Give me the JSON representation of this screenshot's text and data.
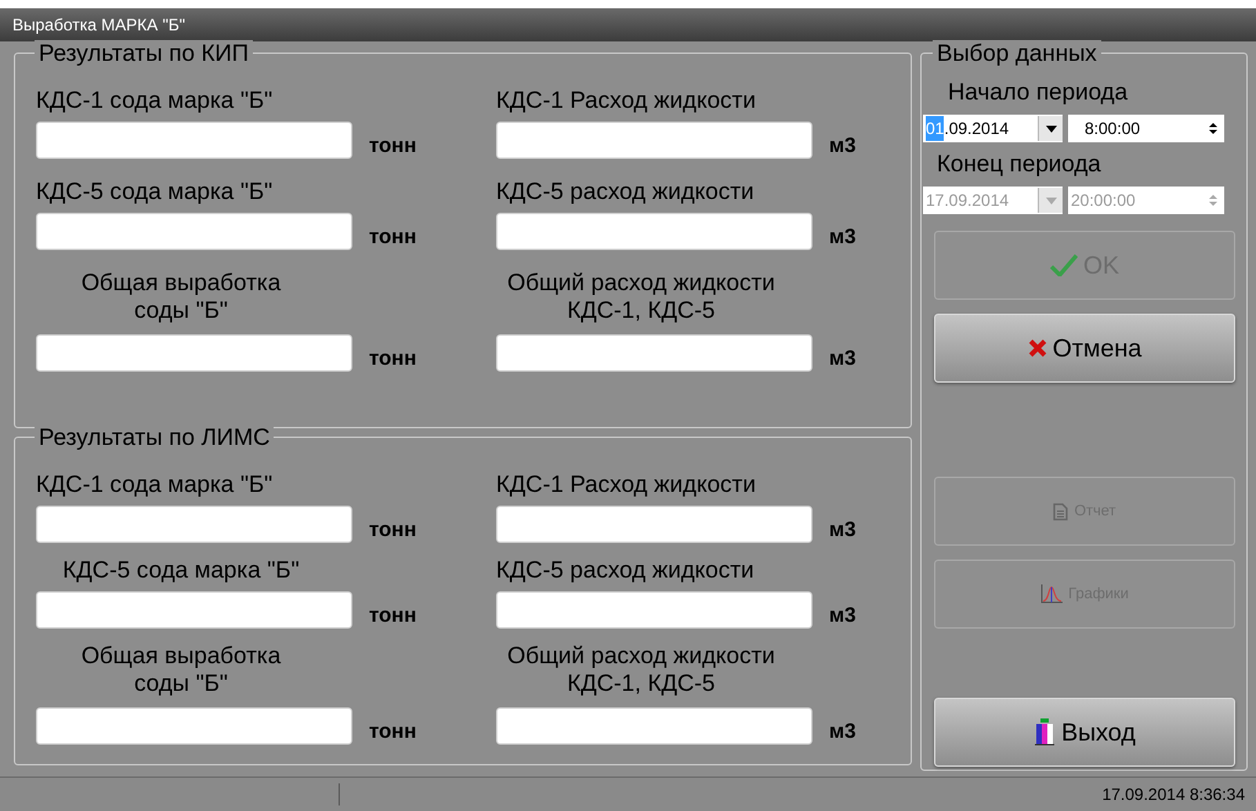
{
  "window": {
    "title": "Выработка МАРКА \"Б\""
  },
  "groups": [
    {
      "title": "Результаты по КИП",
      "fields": [
        {
          "label": "КДС-1 сода марка \"Б\"",
          "unit": "тонн",
          "centered": false
        },
        {
          "label": "КДС-1 Расход жидкости",
          "unit": "м3",
          "centered": false
        },
        {
          "label": "КДС-5 сода марка \"Б\"",
          "unit": "тонн",
          "centered": false
        },
        {
          "label": "КДС-5 расход жидкости",
          "unit": "м3",
          "centered": false
        },
        {
          "label": "Общая выработка\nсоды \"Б\"",
          "unit": "тонн",
          "centered": true
        },
        {
          "label": "Общий расход жидкости\nКДС-1, КДС-5",
          "unit": "м3",
          "centered": true
        }
      ]
    },
    {
      "title": "Результаты по ЛИМС",
      "fields": [
        {
          "label": "КДС-1 сода марка \"Б\"",
          "unit": "тонн",
          "centered": false
        },
        {
          "label": "КДС-1 Расход жидкости",
          "unit": "м3",
          "centered": false
        },
        {
          "label": "КДС-5 сода марка \"Б\"",
          "unit": "тонн",
          "centered": true
        },
        {
          "label": "КДС-5 расход жидкости",
          "unit": "м3",
          "centered": false
        },
        {
          "label": "Общая выработка\nсоды \"Б\"",
          "unit": "тонн",
          "centered": true
        },
        {
          "label": "Общий расход жидкости\nКДС-1, КДС-5",
          "unit": "м3",
          "centered": true
        }
      ]
    }
  ],
  "selection": {
    "title": "Выбор данных",
    "periods": [
      {
        "label": "Начало периода",
        "disabled": false,
        "date_parts": [
          {
            "text": "01",
            "selected": true
          },
          {
            "text": ".09.2014",
            "selected": false
          }
        ],
        "time": "8:00:00"
      },
      {
        "label": "Конец периода",
        "disabled": true,
        "date_parts": [
          {
            "text": "17.09.2014",
            "selected": false
          }
        ],
        "time": "20:00:00"
      }
    ],
    "buttons": [
      {
        "label": "OK",
        "kind": "check",
        "disabled": true
      },
      {
        "label": "Отмена",
        "kind": "cross",
        "disabled": false
      },
      {
        "label": "Отчет",
        "kind": "document",
        "disabled": true
      },
      {
        "label": "Графики",
        "kind": "chart",
        "disabled": true
      },
      {
        "label": "Выход",
        "kind": "exit",
        "disabled": false
      }
    ]
  },
  "status_bar": {
    "time": "17.09.2014 8:36:34"
  }
}
